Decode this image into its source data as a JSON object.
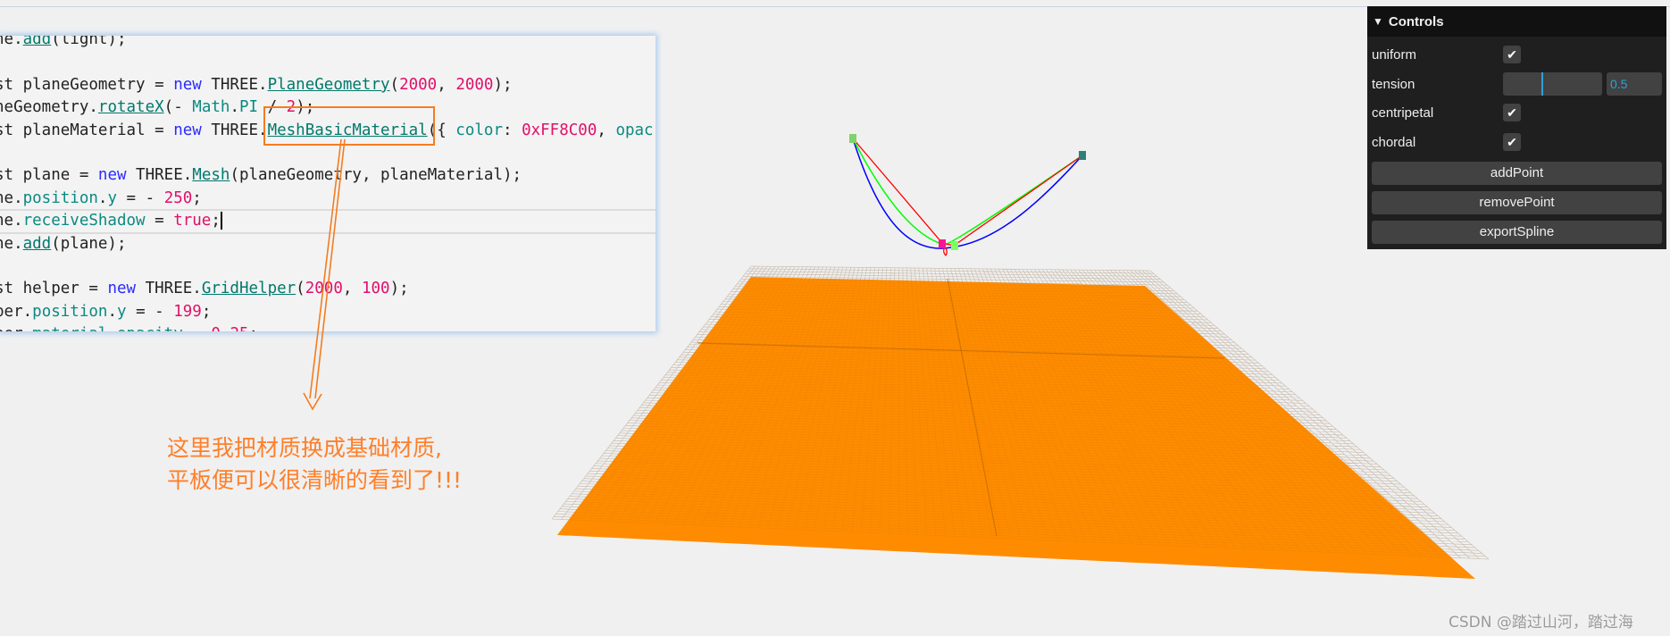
{
  "code": {
    "lines": [
      [
        [
          "ne.",
          ""
        ],
        [
          "add",
          "fn"
        ],
        [
          "(light);",
          ""
        ]
      ],
      [],
      [
        [
          "st planeGeometry = ",
          ""
        ],
        [
          "new",
          "kw"
        ],
        [
          " THREE.",
          ""
        ],
        [
          "PlaneGeometry",
          "fn"
        ],
        [
          "(",
          ""
        ],
        [
          "2000",
          "num"
        ],
        [
          ", ",
          ""
        ],
        [
          "2000",
          "num"
        ],
        [
          ");",
          ""
        ]
      ],
      [
        [
          "neGeometry.",
          ""
        ],
        [
          "rotateX",
          "fn"
        ],
        [
          "(- ",
          ""
        ],
        [
          "Math",
          "prop"
        ],
        [
          ".",
          ""
        ],
        [
          "PI",
          "prop"
        ],
        [
          " / ",
          ""
        ],
        [
          "2",
          "num"
        ],
        [
          ");",
          ""
        ]
      ],
      [
        [
          "st planeMaterial = ",
          ""
        ],
        [
          "new",
          "kw"
        ],
        [
          " THREE.",
          ""
        ],
        [
          "MeshBasicMaterial",
          "fn"
        ],
        [
          "({ ",
          ""
        ],
        [
          "color",
          "prop"
        ],
        [
          ": ",
          ""
        ],
        [
          "0xFF8C00",
          "num"
        ],
        [
          ", ",
          ""
        ],
        [
          "opac",
          "prop"
        ]
      ],
      [],
      [
        [
          "st plane = ",
          ""
        ],
        [
          "new",
          "kw"
        ],
        [
          " THREE.",
          ""
        ],
        [
          "Mesh",
          "fn"
        ],
        [
          "(planeGeometry, planeMaterial);",
          ""
        ]
      ],
      [
        [
          "ne.",
          ""
        ],
        [
          "position",
          "prop"
        ],
        [
          ".",
          ""
        ],
        [
          "y",
          "prop"
        ],
        [
          " = - ",
          ""
        ],
        [
          "250",
          "num"
        ],
        [
          ";",
          ""
        ]
      ],
      [
        [
          "ne.",
          ""
        ],
        [
          "receiveShadow",
          "prop"
        ],
        [
          " = ",
          ""
        ],
        [
          "true",
          "num"
        ],
        [
          ";",
          "cursor"
        ]
      ],
      [
        [
          "ne.",
          ""
        ],
        [
          "add",
          "fn"
        ],
        [
          "(plane);",
          ""
        ]
      ],
      [],
      [
        [
          "st helper = ",
          ""
        ],
        [
          "new",
          "kw"
        ],
        [
          " THREE.",
          ""
        ],
        [
          "GridHelper",
          "fn"
        ],
        [
          "(",
          ""
        ],
        [
          "2000",
          "num"
        ],
        [
          ", ",
          ""
        ],
        [
          "100",
          "num"
        ],
        [
          ");",
          ""
        ]
      ],
      [
        [
          "per.",
          ""
        ],
        [
          "position",
          "prop"
        ],
        [
          ".",
          ""
        ],
        [
          "y",
          "prop"
        ],
        [
          " = - ",
          ""
        ],
        [
          "199",
          "num"
        ],
        [
          ";",
          ""
        ]
      ],
      [
        [
          "per.",
          ""
        ],
        [
          "material",
          "prop"
        ],
        [
          ".",
          ""
        ],
        [
          "opacity",
          "prop"
        ],
        [
          " = ",
          ""
        ],
        [
          "0.25",
          "num"
        ],
        [
          ";",
          ""
        ]
      ]
    ],
    "highlighted_line": 8
  },
  "annotation": {
    "line1": "这里我把材质换成基础材质,",
    "line2": "平板便可以很清晰的看到了!!!",
    "color": "#ff7f2a"
  },
  "scene": {
    "plane_color": "#ff8c00",
    "grid_divisions": 100,
    "spline_colors": {
      "uniform": "#ff0000",
      "centripetal": "#00ff00",
      "chordal": "#0000ff"
    },
    "control_point_colors": [
      "#7fd36a",
      "#2f7f78",
      "#ff1493",
      "#7fff60"
    ]
  },
  "controls": {
    "title": "Controls",
    "uniform": {
      "label": "uniform",
      "checked": true
    },
    "tension": {
      "label": "tension",
      "value": "0.5",
      "fraction": 0.5
    },
    "centripetal": {
      "label": "centripetal",
      "checked": true
    },
    "chordal": {
      "label": "chordal",
      "checked": true
    },
    "buttons": [
      "addPoint",
      "removePoint",
      "exportSpline"
    ],
    "check_glyph": "✔",
    "chevron_glyph": "▼"
  },
  "watermark": "CSDN @踏过山河，踏过海"
}
